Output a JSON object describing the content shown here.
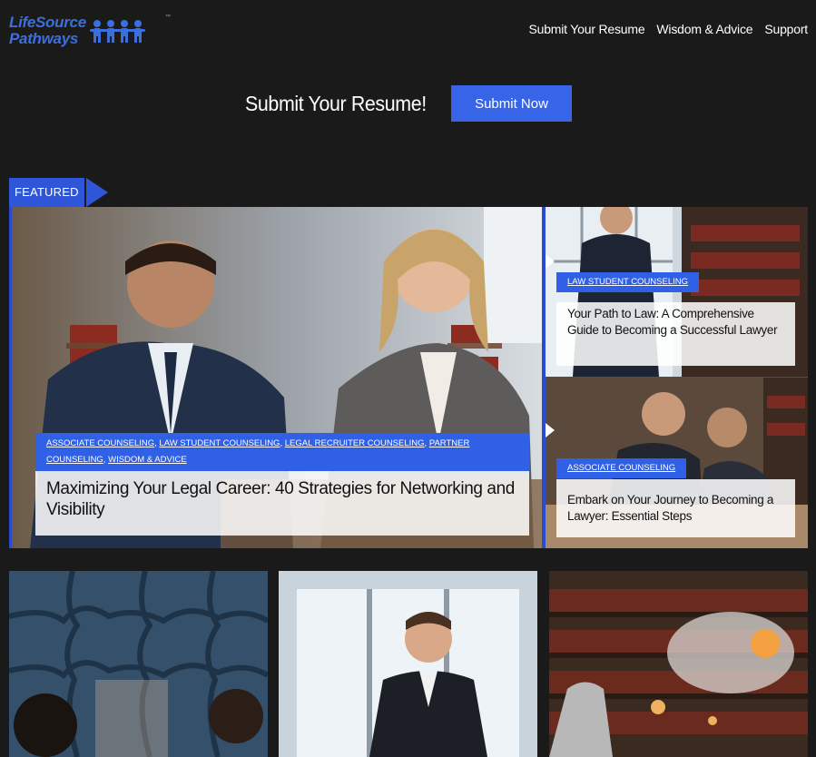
{
  "header": {
    "logo_line1": "LifeSource",
    "logo_line2": "Pathways",
    "logo_tm": "™",
    "nav": [
      "Submit Your Resume",
      "Wisdom & Advice",
      "Support"
    ]
  },
  "cta": {
    "text": "Submit Your Resume!",
    "button": "Submit Now"
  },
  "featured": {
    "tag": "FEATURED",
    "main": {
      "categories": [
        "ASSOCIATE COUNSELING",
        "LAW STUDENT COUNSELING",
        "LEGAL RECRUITER COUNSELING",
        "PARTNER COUNSELING",
        "WISDOM & ADVICE"
      ],
      "title": "Maximizing Your Legal Career: 40 Strategies for Networking and Visibility"
    },
    "side": [
      {
        "category": "LAW STUDENT COUNSELING",
        "title": "Your Path to Law: A Comprehensive Guide to Becoming a Successful Lawyer"
      },
      {
        "category": "ASSOCIATE COUNSELING",
        "title": "Embark on Your Journey to Becoming a Lawyer: Essential Steps"
      }
    ]
  },
  "colors": {
    "accent": "#3060e6",
    "background": "#1a1a1a"
  }
}
